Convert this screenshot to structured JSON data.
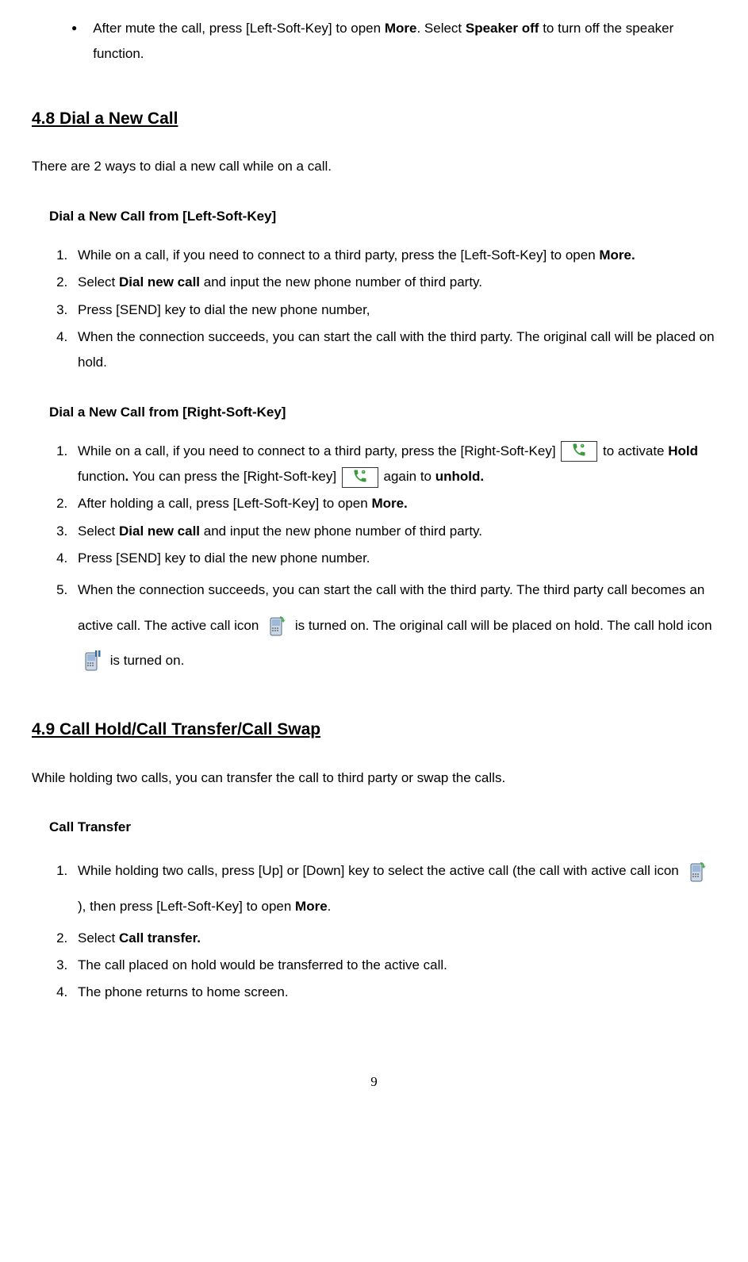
{
  "bullet": {
    "text_a": "After mute the call, press [Left-Soft-Key] to open ",
    "more": "More",
    "text_b": ". Select ",
    "speaker_off": "Speaker off",
    "text_c": " to turn off the speaker function."
  },
  "s48": {
    "heading": "4.8 Dial a New Call",
    "intro": "There are 2 ways to dial a new call while on a call.",
    "sub1": {
      "title": "Dial a New Call from [Left-Soft-Key]",
      "li1_a": "While on a call, if you need to connect to a third party, press the [Left-Soft-Key] to open ",
      "li1_b": "More.",
      "li2_a": "Select ",
      "li2_b": "Dial new call",
      "li2_c": " and input the new phone number of third party.",
      "li3": "Press [SEND] key to dial the new phone number,",
      "li4": "When the connection succeeds, you can start the call with the third party. The original call will be placed on hold."
    },
    "sub2": {
      "title": "Dial a New Call from [Right-Soft-Key]",
      "li1_a": "While on a call, if you need to connect to a third party, press the [Right-Soft-Key] ",
      "li1_b": " to activate ",
      "li1_hold": "Hold",
      "li1_c": " function",
      "li1_d": ".",
      "li1_e": "  You can press the [Right-Soft-key] ",
      "li1_f": "again to ",
      "li1_unhold": "unhold.",
      "li2_a": "After holding a call, press [Left-Soft-Key] to open ",
      "li2_b": "More.",
      "li3_a": "Select ",
      "li3_b": "Dial new call",
      "li3_c": " and input the new phone number of third party.",
      "li4": "Press [SEND] key to dial the new phone number.",
      "li5_a": "When the connection succeeds, you can start the call with the third party. The third party call becomes an active call. The active call icon ",
      "li5_b": " is turned on. The original call will be placed on hold. The call hold icon ",
      "li5_c": "is turned on."
    }
  },
  "s49": {
    "heading": "4.9 Call Hold/Call Transfer/Call Swap",
    "intro": "While holding two calls, you can transfer the call to third party or swap the calls.",
    "sub1": {
      "title": "Call Transfer",
      "li1_a": "While holding two calls, press [Up] or [Down] key to select the active call (the call with active call icon ",
      "li1_b": " ), then press [Left-Soft-Key] to open ",
      "li1_more": "More",
      "li1_c": ".",
      "li2_a": "Select ",
      "li2_b": "Call transfer.",
      "li3": "The call placed on hold would be transferred to the active call.",
      "li4": " The phone returns to home screen."
    }
  },
  "page": "9"
}
